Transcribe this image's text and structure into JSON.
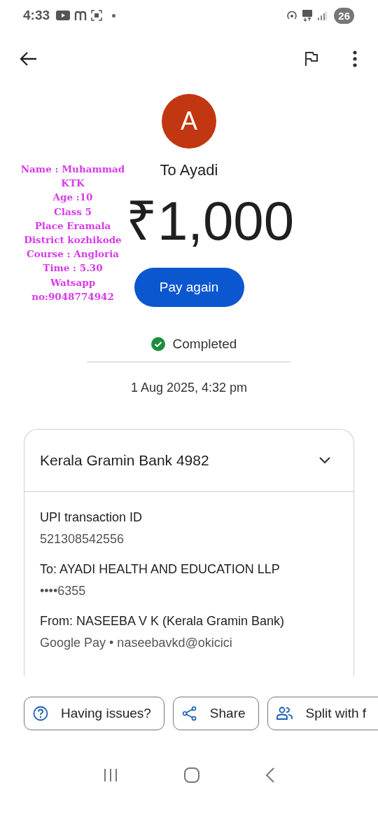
{
  "status_bar": {
    "time": "4:33",
    "battery": "26"
  },
  "recipient": {
    "initial": "A",
    "name": "To Ayadi"
  },
  "amount": "₹1,000",
  "pay_again": "Pay again",
  "status": "Completed",
  "date": "1 Aug 2025, 4:32 pm",
  "bank_card": {
    "title": "Kerala Gramin Bank 4982",
    "expanded": true,
    "details": [
      {
        "label": "UPI transaction ID",
        "value": "521308542556"
      },
      {
        "label": "To: AYADI HEALTH AND EDUCATION LLP",
        "value": "••••6355"
      },
      {
        "label": "From: NASEEBA V K (Kerala Gramin Bank)",
        "value": "Google Pay • naseebavkd@okicici"
      }
    ]
  },
  "actions": [
    {
      "kind": "help",
      "label": "Having issues?"
    },
    {
      "kind": "share",
      "label": "Share"
    },
    {
      "kind": "split",
      "label": "Split with f"
    }
  ],
  "annotation": {
    "lines": [
      "Name : Muhammad",
      "KTK",
      "Age :10",
      "Class 5",
      "Place Eramala",
      "District kozhikode",
      "Course : Angloria",
      "Time : 5.30",
      "Watsapp",
      "no:9048774942"
    ]
  }
}
